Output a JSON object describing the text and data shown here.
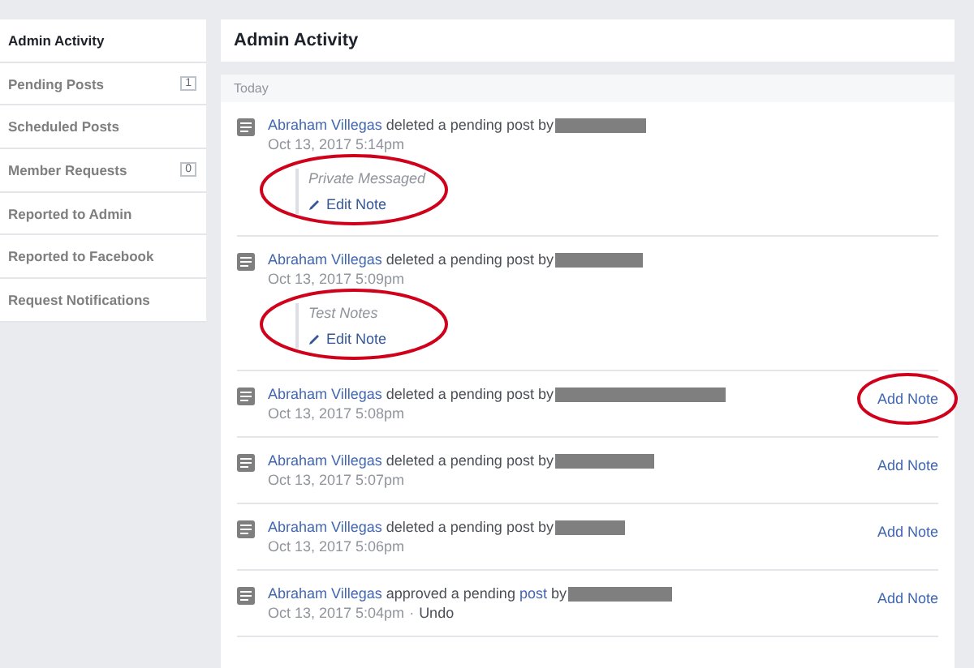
{
  "sidebar": {
    "items": [
      {
        "label": "Admin Activity",
        "selected": true
      },
      {
        "label": "Pending Posts",
        "selected": false,
        "count": "1"
      },
      {
        "label": "Scheduled Posts",
        "selected": false
      },
      {
        "label": "Member Requests",
        "selected": false,
        "count": "0"
      },
      {
        "label": "Reported to Admin",
        "selected": false
      },
      {
        "label": "Reported to Facebook",
        "selected": false
      },
      {
        "label": "Request Notifications",
        "selected": false
      }
    ]
  },
  "header": {
    "title": "Admin Activity"
  },
  "activity": {
    "section": "Today",
    "entries": [
      {
        "segments": [
          {
            "kind": "link",
            "text": "Abraham Villegas"
          },
          {
            "kind": "text",
            "text": " deleted a pending post by"
          }
        ],
        "time": "Oct 13, 2017 5:14pm",
        "note": {
          "text": "Private Messaged",
          "action": "Edit Note",
          "circled": true
        }
      },
      {
        "segments": [
          {
            "kind": "link",
            "text": "Abraham Villegas"
          },
          {
            "kind": "text",
            "text": " deleted a pending post by"
          }
        ],
        "time": "Oct 13, 2017 5:09pm",
        "note": {
          "text": "Test Notes",
          "action": "Edit Note",
          "circled": true
        }
      },
      {
        "segments": [
          {
            "kind": "link",
            "text": "Abraham Villegas"
          },
          {
            "kind": "text",
            "text": " deleted a pending post by"
          }
        ],
        "time": "Oct 13, 2017 5:08pm",
        "add_note": {
          "label": "Add Note",
          "circled": true
        }
      },
      {
        "segments": [
          {
            "kind": "link",
            "text": "Abraham Villegas"
          },
          {
            "kind": "text",
            "text": " deleted a pending post by"
          }
        ],
        "time": "Oct 13, 2017 5:07pm",
        "add_note": {
          "label": "Add Note",
          "circled": false
        }
      },
      {
        "segments": [
          {
            "kind": "link",
            "text": "Abraham Villegas"
          },
          {
            "kind": "text",
            "text": " deleted a pending post by"
          }
        ],
        "time": "Oct 13, 2017 5:06pm",
        "add_note": {
          "label": "Add Note",
          "circled": false
        }
      },
      {
        "segments": [
          {
            "kind": "link",
            "text": "Abraham Villegas"
          },
          {
            "kind": "text",
            "text": " approved a pending "
          },
          {
            "kind": "link",
            "text": "post"
          },
          {
            "kind": "text",
            "text": " by"
          }
        ],
        "time": "Oct 13, 2017 5:04pm",
        "undo": {
          "separator": "·",
          "label": "Undo"
        },
        "add_note": {
          "label": "Add Note",
          "circled": false
        }
      }
    ]
  }
}
